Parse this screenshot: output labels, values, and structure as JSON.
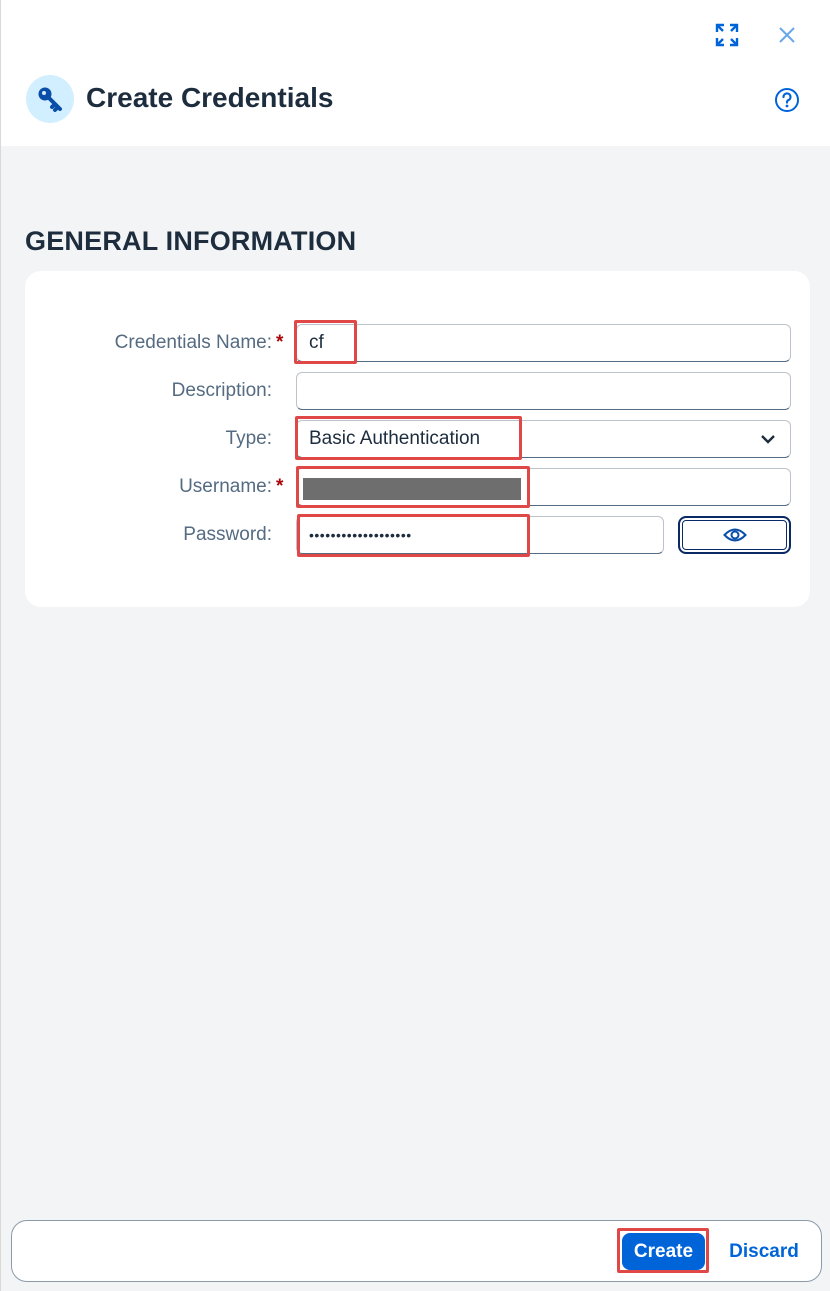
{
  "header": {
    "title": "Create Credentials",
    "icons": {
      "title": "key-icon",
      "fullscreen": "fullscreen-icon",
      "close": "close-icon",
      "help": "help-icon"
    }
  },
  "section": {
    "title": "GENERAL INFORMATION"
  },
  "form": {
    "credentials_name": {
      "label": "Credentials Name:",
      "value": "cf",
      "required": true
    },
    "description": {
      "label": "Description:",
      "value": ""
    },
    "type": {
      "label": "Type:",
      "value": "Basic Authentication"
    },
    "username": {
      "label": "Username:",
      "value": "",
      "required": true,
      "redacted": true
    },
    "password": {
      "label": "Password:",
      "value": "•••••••••••••••••••"
    },
    "required_marker": "*"
  },
  "footer": {
    "create_label": "Create",
    "discard_label": "Discard"
  },
  "colors": {
    "accent": "#0064d9",
    "highlight": "#e04848",
    "required": "#aa0808"
  }
}
